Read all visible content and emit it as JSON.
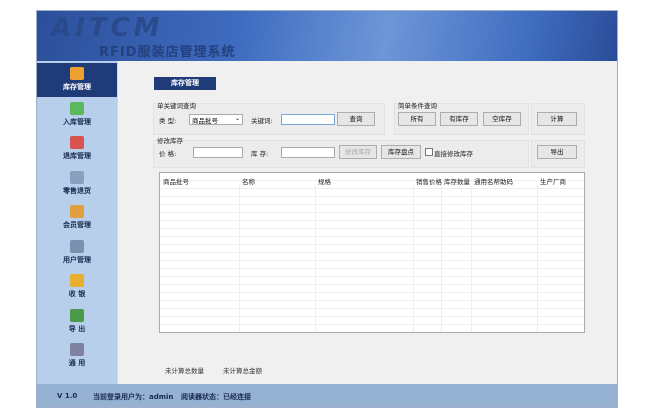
{
  "header": {
    "logo": "AITCM",
    "title": "RFID服装店管理系统"
  },
  "sidebar": {
    "items": [
      {
        "label": "库存管理",
        "icon": "inventory-icon",
        "active": true
      },
      {
        "label": "入库管理",
        "icon": "stock-in-icon"
      },
      {
        "label": "退库管理",
        "icon": "stock-return-icon"
      },
      {
        "label": "零售退货",
        "icon": "retail-return-icon"
      },
      {
        "label": "会员管理",
        "icon": "members-icon"
      },
      {
        "label": "用户管理",
        "icon": "users-icon"
      },
      {
        "label": "收 银",
        "icon": "cashier-icon"
      },
      {
        "label": "导 出",
        "icon": "export-icon"
      },
      {
        "label": "通 用",
        "icon": "general-icon"
      }
    ]
  },
  "page_tab": "库存管理",
  "keyword_group": {
    "title": "单关键词查询",
    "type_label": "类  型:",
    "type_value": "商品批号",
    "keyword_label": "关键词:",
    "keyword_value": "",
    "query": "查询"
  },
  "simple_group": {
    "title": "简单条件查询",
    "all": "所有",
    "in_stock": "有库存",
    "empty": "空库存"
  },
  "calc": "计算",
  "modify_group": {
    "title": "修改库存",
    "price_label": "价  格:",
    "price_value": "",
    "stock_label": "库  存:",
    "stock_value": "",
    "modify": "修改库存",
    "inventory_check": "库存盘点",
    "direct_modify": "直接修改库存",
    "direct_modify_checked": false
  },
  "export": "导出",
  "table": {
    "columns": [
      "商品批号",
      "名称",
      "规格",
      "销售价格",
      "库存数量",
      "通用名帮助码",
      "生产厂商"
    ],
    "rows": []
  },
  "footer": {
    "total_qty": "未计算总数量",
    "total_amount": "未计算总金额"
  },
  "status": {
    "version": "V 1.0",
    "user": "当前登录用户为：admin",
    "reader": "阅读器状态：已经连接"
  }
}
